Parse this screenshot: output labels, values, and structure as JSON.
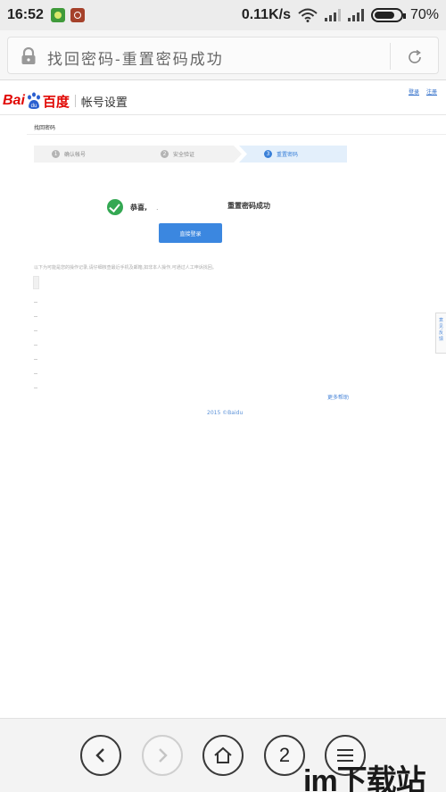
{
  "status_bar": {
    "time": "16:52",
    "network_speed": "0.11K/s",
    "battery": "70%"
  },
  "browser": {
    "page_title": "找回密码-重置密码成功"
  },
  "header": {
    "logo_latin": "Bai",
    "logo_chinese": "百度",
    "section_name": "帐号设置",
    "links": [
      "登录",
      "注册"
    ]
  },
  "main": {
    "section_title": "找回密码",
    "steps": [
      {
        "number": "1",
        "label": "确认帐号",
        "active": false
      },
      {
        "number": "2",
        "label": "安全验证",
        "active": false
      },
      {
        "number": "3",
        "label": "重置密码",
        "active": true
      }
    ],
    "success_prefix": "恭喜,",
    "success_suffix": "重置密码成功",
    "login_button": "直接登录",
    "notice": "以下为可能是您的操作记录,请仔细核查最近手机及邮箱,如非本人操作,可通过人工申诉找回。",
    "more_link": "更多帮助",
    "copyright": "2015 ©Baidu"
  },
  "side_tab": {
    "label": "意见反馈"
  },
  "bottom_nav": {
    "tab_count": "2"
  },
  "watermark": {
    "text": "im下载站"
  },
  "colors": {
    "accent": "#3b87e0",
    "brand_red": "#e10602",
    "success_green": "#34a853"
  }
}
